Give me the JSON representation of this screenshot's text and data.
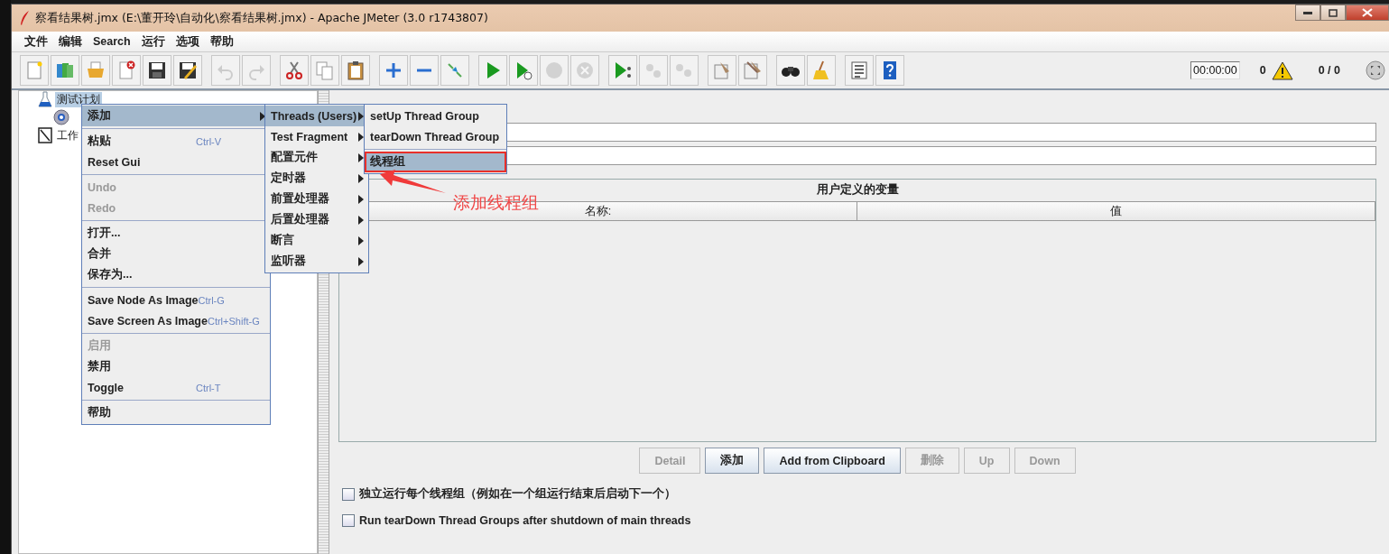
{
  "window": {
    "title": "察看结果树.jmx (E:\\董开玲\\自动化\\察看结果树.jmx) - Apache JMeter (3.0 r1743807)"
  },
  "menu_bar": [
    "文件",
    "编辑",
    "Search",
    "运行",
    "选项",
    "帮助"
  ],
  "toolbar": [
    [
      {
        "kind": "new",
        "disabled": false
      },
      {
        "kind": "templates",
        "disabled": false
      },
      {
        "kind": "open",
        "disabled": false
      },
      {
        "kind": "close",
        "disabled": false
      },
      {
        "kind": "save",
        "disabled": false
      },
      {
        "kind": "save-as",
        "disabled": false
      }
    ],
    [
      {
        "kind": "undo",
        "disabled": true
      },
      {
        "kind": "redo",
        "disabled": true
      }
    ],
    [
      {
        "kind": "cut",
        "disabled": false
      },
      {
        "kind": "copy",
        "disabled": false
      },
      {
        "kind": "paste",
        "disabled": false
      }
    ],
    [
      {
        "kind": "expand",
        "disabled": false
      },
      {
        "kind": "collapse",
        "disabled": false
      },
      {
        "kind": "toggle",
        "disabled": false
      }
    ],
    [
      {
        "kind": "start",
        "disabled": false
      },
      {
        "kind": "start-no-pause",
        "disabled": false
      },
      {
        "kind": "stop",
        "disabled": true
      },
      {
        "kind": "shutdown",
        "disabled": true
      }
    ],
    [
      {
        "kind": "remote-start",
        "disabled": false
      },
      {
        "kind": "remote-stop",
        "disabled": true
      },
      {
        "kind": "remote-exit",
        "disabled": true
      }
    ],
    [
      {
        "kind": "clear",
        "disabled": false
      },
      {
        "kind": "clear-all",
        "disabled": false
      }
    ],
    [
      {
        "kind": "search",
        "disabled": false
      },
      {
        "kind": "reset-search",
        "disabled": false
      }
    ],
    [
      {
        "kind": "function-helper",
        "disabled": false
      },
      {
        "kind": "help",
        "disabled": false
      }
    ]
  ],
  "status": {
    "timer": "00:00:00",
    "error_count": "0",
    "threads": "0 / 0"
  },
  "tree": [
    {
      "kind": "test-plan",
      "label": "测试计划",
      "selected": true,
      "children": [
        {
          "kind": "config"
        }
      ]
    },
    {
      "kind": "workbench",
      "label": "工作",
      "selected": false
    }
  ],
  "variables_table": {
    "title": "用户定义的变量",
    "columns": [
      "名称:",
      "值"
    ]
  },
  "buttons": [
    {
      "label": "Detail",
      "disabled": true
    },
    {
      "label": "添加",
      "disabled": false
    },
    {
      "label": "Add from Clipboard",
      "disabled": false
    },
    {
      "label": "删除",
      "disabled": true
    },
    {
      "label": "Up",
      "disabled": true
    },
    {
      "label": "Down",
      "disabled": true
    }
  ],
  "checkboxes": [
    {
      "label": "独立运行每个线程组（例如在一个组运行结束后启动下一个）",
      "checked": false
    },
    {
      "label": "Run tearDown Thread Groups after shutdown of main threads",
      "checked": false
    }
  ],
  "context_menu": {
    "groups": [
      [
        {
          "label": "添加",
          "selected": true,
          "disabled": false,
          "submenu": true
        }
      ],
      [
        {
          "label": "粘贴",
          "shortcut": "Ctrl-V",
          "selected": false,
          "disabled": false,
          "submenu": false
        },
        {
          "label": "Reset Gui",
          "selected": false,
          "disabled": false,
          "submenu": false
        }
      ],
      [
        {
          "label": "Undo",
          "selected": false,
          "disabled": true,
          "submenu": false
        },
        {
          "label": "Redo",
          "selected": false,
          "disabled": true,
          "submenu": false
        }
      ],
      [
        {
          "label": "打开...",
          "selected": false,
          "disabled": false,
          "submenu": false
        },
        {
          "label": "合并",
          "selected": false,
          "disabled": false,
          "submenu": false
        },
        {
          "label": "保存为...",
          "selected": false,
          "disabled": false,
          "submenu": false
        }
      ],
      [
        {
          "label": "Save Node As Image",
          "shortcut": "Ctrl-G",
          "selected": false,
          "disabled": false,
          "submenu": false
        },
        {
          "label": "Save Screen As Image",
          "shortcut": "Ctrl+Shift-G",
          "selected": false,
          "disabled": false,
          "submenu": false
        }
      ],
      [
        {
          "label": "启用",
          "selected": false,
          "disabled": true,
          "submenu": false
        },
        {
          "label": "禁用",
          "selected": false,
          "disabled": false,
          "submenu": false
        },
        {
          "label": "Toggle",
          "shortcut": "Ctrl-T",
          "selected": false,
          "disabled": false,
          "submenu": false
        }
      ],
      [
        {
          "label": "帮助",
          "selected": false,
          "disabled": false,
          "submenu": false
        }
      ]
    ]
  },
  "add_submenu": {
    "groups": [
      [
        {
          "label": "Threads (Users)",
          "selected": true,
          "disabled": false,
          "submenu": true
        },
        {
          "label": "Test Fragment",
          "selected": false,
          "disabled": false,
          "submenu": true
        },
        {
          "label": "配置元件",
          "selected": false,
          "disabled": false,
          "submenu": true
        },
        {
          "label": "定时器",
          "selected": false,
          "disabled": false,
          "submenu": true
        },
        {
          "label": "前置处理器",
          "selected": false,
          "disabled": false,
          "submenu": true
        },
        {
          "label": "后置处理器",
          "selected": false,
          "disabled": false,
          "submenu": true
        },
        {
          "label": "断言",
          "selected": false,
          "disabled": false,
          "submenu": true
        },
        {
          "label": "监听器",
          "selected": false,
          "disabled": false,
          "submenu": true
        }
      ]
    ]
  },
  "threads_submenu": {
    "groups": [
      [
        {
          "label": "setUp Thread Group",
          "selected": false,
          "disabled": false,
          "submenu": false
        },
        {
          "label": "tearDown Thread Group",
          "selected": false,
          "disabled": false,
          "submenu": false
        }
      ],
      [
        {
          "label": "线程组",
          "selected": true,
          "disabled": false,
          "submenu": false,
          "highlighted": true
        }
      ]
    ]
  },
  "annotation": {
    "label": "添加线程组"
  }
}
